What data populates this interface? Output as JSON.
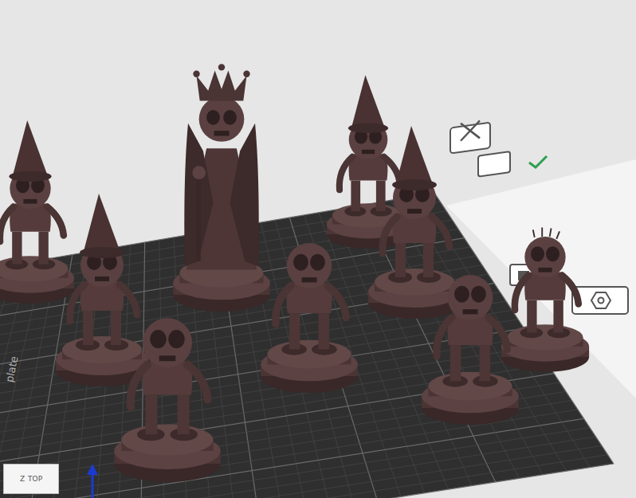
{
  "viewport": {
    "plate_label": "plate",
    "view_cube_label": "TOP",
    "axis_label": "Z"
  },
  "figures": [
    {
      "kind": "cone"
    },
    {
      "kind": "cone"
    },
    {
      "kind": "queen"
    },
    {
      "kind": "plain"
    },
    {
      "kind": "plain"
    },
    {
      "kind": "cone"
    },
    {
      "kind": "cone"
    },
    {
      "kind": "plain"
    },
    {
      "kind": "spiky"
    }
  ]
}
